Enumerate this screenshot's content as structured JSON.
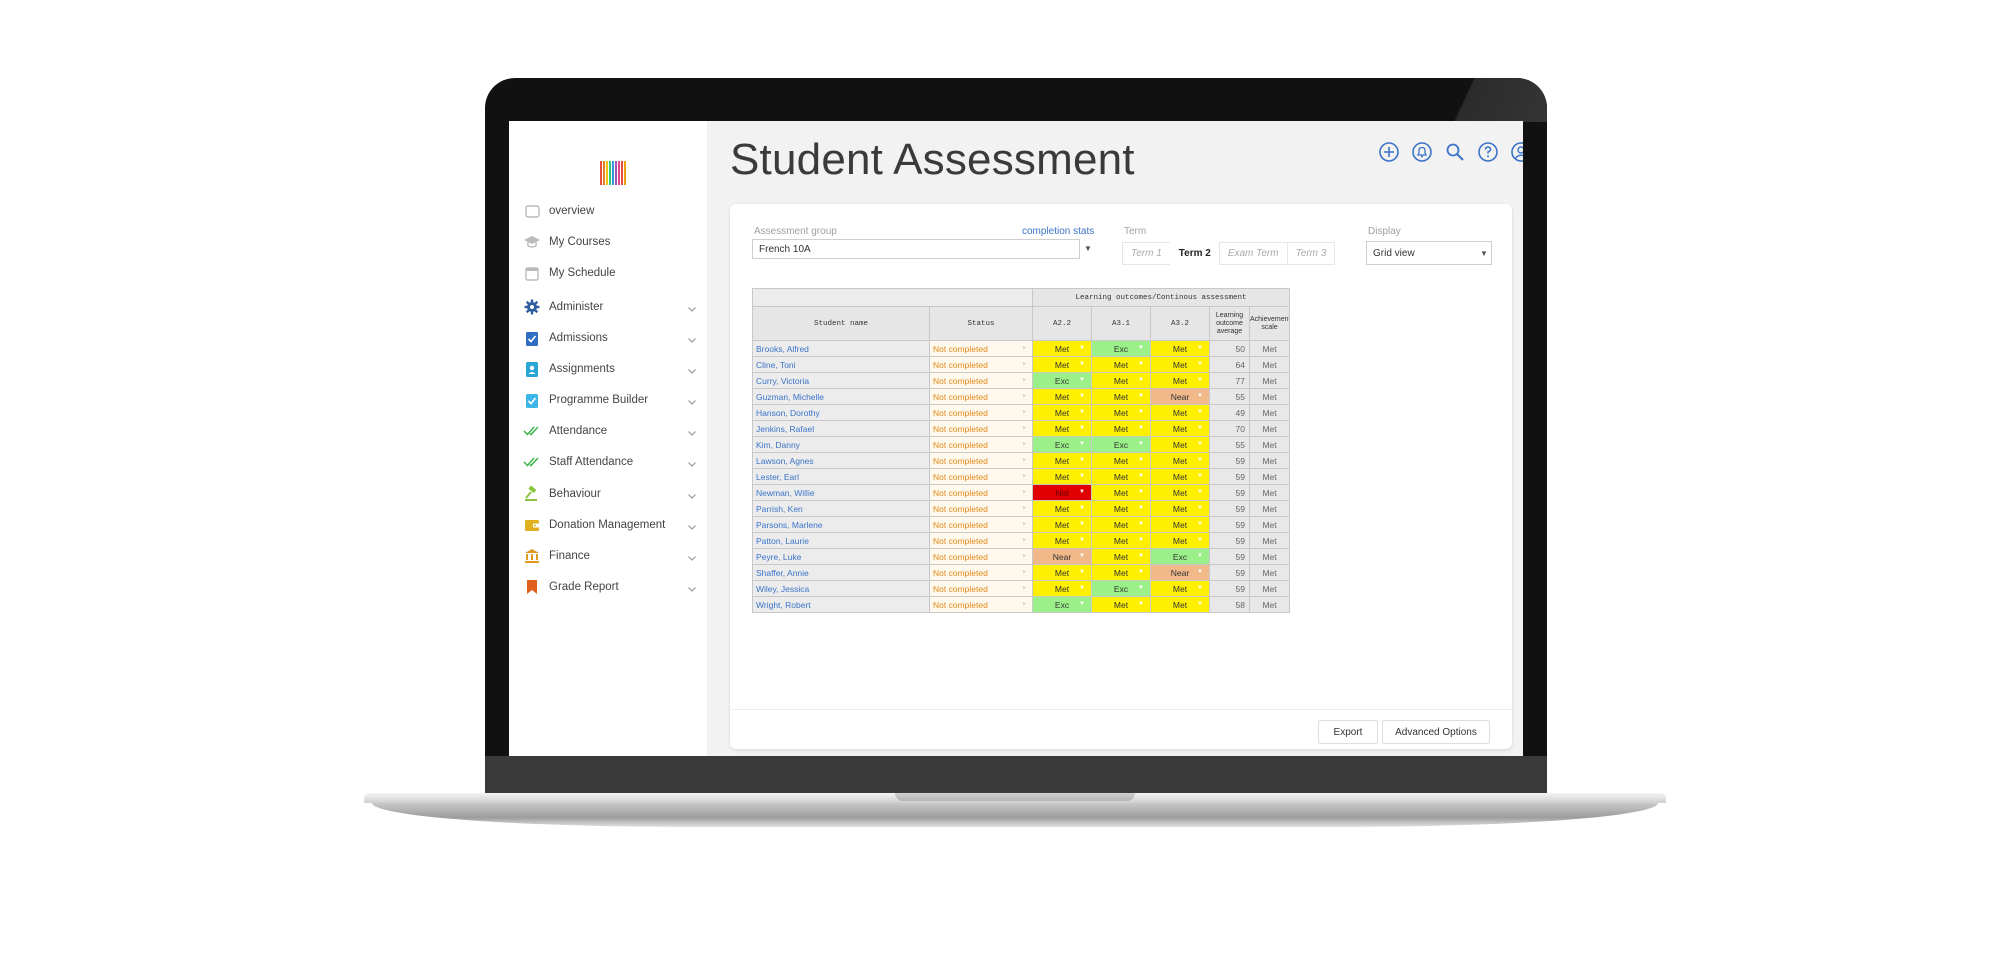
{
  "sidebar": {
    "logo_colors": [
      "#e74c3c",
      "#e67e22",
      "#f1c40f",
      "#2ecc71",
      "#3498db",
      "#9b59b6",
      "#e84393",
      "#e74c3c",
      "#f39c12"
    ],
    "items": [
      {
        "label": "overview",
        "icon": "square-outline-icon",
        "color": "#bbbbbb",
        "expandable": false
      },
      {
        "label": "My Courses",
        "icon": "graduation-cap-icon",
        "color": "#bbbbbb",
        "expandable": false
      },
      {
        "label": "My Schedule",
        "icon": "calendar-icon",
        "color": "#bbbbbb",
        "expandable": false
      },
      {
        "label": "Administer",
        "icon": "gear-icon",
        "color": "#2f5f9e",
        "expandable": true
      },
      {
        "label": "Admissions",
        "icon": "clipboard-check-icon",
        "color": "#2e6fc4",
        "expandable": true
      },
      {
        "label": "Assignments",
        "icon": "id-badge-icon",
        "color": "#2aa6d6",
        "expandable": true
      },
      {
        "label": "Programme Builder",
        "icon": "clipboard-check-light-icon",
        "color": "#3cb6e8",
        "expandable": true
      },
      {
        "label": "Attendance",
        "icon": "double-check-icon",
        "color": "#3fb54a",
        "expandable": true
      },
      {
        "label": "Staff Attendance",
        "icon": "double-check-icon",
        "color": "#3fb54a",
        "expandable": true
      },
      {
        "label": "Behaviour",
        "icon": "gavel-icon",
        "color": "#8ac43f",
        "expandable": true
      },
      {
        "label": "Donation Management",
        "icon": "wallet-icon",
        "color": "#e0b020",
        "expandable": true
      },
      {
        "label": "Finance",
        "icon": "bank-icon",
        "color": "#e09a20",
        "expandable": true
      },
      {
        "label": "Grade Report",
        "icon": "bookmark-icon",
        "color": "#e0601e",
        "expandable": true
      }
    ]
  },
  "header": {
    "title": "Student Assessment",
    "icons": [
      "add-circle-icon",
      "bell-circle-icon",
      "search-icon",
      "help-circle-icon",
      "user-circle-icon"
    ],
    "icon_color": "#3b73c8"
  },
  "filters": {
    "assessment_group_label": "Assessment group",
    "assessment_group_value": "French 10A",
    "completion_stats_link": "completion stats",
    "term_label": "Term",
    "terms": [
      "Term 1",
      "Term 2",
      "Exam Term",
      "Term 3"
    ],
    "active_term": "Term 2",
    "display_label": "Display",
    "display_value": "Grid view"
  },
  "grid": {
    "group_header": "Learning outcomes/Continous assessment",
    "columns": {
      "name": "Student name",
      "status": "Status",
      "outcomes": [
        "A2.2",
        "A3.1",
        "A3.2"
      ],
      "average": [
        "Learning",
        "outcome",
        "average"
      ],
      "scale": [
        "Achievement",
        "scale"
      ]
    },
    "rows": [
      {
        "name": "Brooks, Alfred",
        "status": "Not completed",
        "grades": [
          "Met",
          "Exc",
          "Met"
        ],
        "avg": "50",
        "scale": "Met"
      },
      {
        "name": "Cline, Toni",
        "status": "Not completed",
        "grades": [
          "Met",
          "Met",
          "Met"
        ],
        "avg": "64",
        "scale": "Met"
      },
      {
        "name": "Curry, Victoria",
        "status": "Not completed",
        "grades": [
          "Exc",
          "Met",
          "Met"
        ],
        "avg": "77",
        "scale": "Met"
      },
      {
        "name": "Guzman, Michelle",
        "status": "Not completed",
        "grades": [
          "Met",
          "Met",
          "Near"
        ],
        "avg": "55",
        "scale": "Met"
      },
      {
        "name": "Hanson, Dorothy",
        "status": "Not completed",
        "grades": [
          "Met",
          "Met",
          "Met"
        ],
        "avg": "49",
        "scale": "Met"
      },
      {
        "name": "Jenkins, Rafael",
        "status": "Not completed",
        "grades": [
          "Met",
          "Met",
          "Met"
        ],
        "avg": "70",
        "scale": "Met"
      },
      {
        "name": "Kim, Danny",
        "status": "Not completed",
        "grades": [
          "Exc",
          "Exc",
          "Met"
        ],
        "avg": "55",
        "scale": "Met"
      },
      {
        "name": "Lawson, Agnes",
        "status": "Not completed",
        "grades": [
          "Met",
          "Met",
          "Met"
        ],
        "avg": "59",
        "scale": "Met"
      },
      {
        "name": "Lester, Earl",
        "status": "Not completed",
        "grades": [
          "Met",
          "Met",
          "Met"
        ],
        "avg": "59",
        "scale": "Met"
      },
      {
        "name": "Newman, Willie",
        "status": "Not completed",
        "grades": [
          "Not",
          "Met",
          "Met"
        ],
        "avg": "59",
        "scale": "Met"
      },
      {
        "name": "Parrish, Ken",
        "status": "Not completed",
        "grades": [
          "Met",
          "Met",
          "Met"
        ],
        "avg": "59",
        "scale": "Met"
      },
      {
        "name": "Parsons, Marlene",
        "status": "Not completed",
        "grades": [
          "Met",
          "Met",
          "Met"
        ],
        "avg": "59",
        "scale": "Met"
      },
      {
        "name": "Patton, Laurie",
        "status": "Not completed",
        "grades": [
          "Met",
          "Met",
          "Met"
        ],
        "avg": "59",
        "scale": "Met"
      },
      {
        "name": "Peyre, Luke",
        "status": "Not completed",
        "grades": [
          "Near",
          "Met",
          "Exc"
        ],
        "avg": "59",
        "scale": "Met"
      },
      {
        "name": "Shaffer, Annie",
        "status": "Not completed",
        "grades": [
          "Met",
          "Met",
          "Near"
        ],
        "avg": "59",
        "scale": "Met"
      },
      {
        "name": "Wiley, Jessica",
        "status": "Not completed",
        "grades": [
          "Met",
          "Exc",
          "Met"
        ],
        "avg": "59",
        "scale": "Met"
      },
      {
        "name": "Wright, Robert",
        "status": "Not completed",
        "grades": [
          "Exc",
          "Met",
          "Met"
        ],
        "avg": "58",
        "scale": "Met"
      }
    ]
  },
  "footer": {
    "export_label": "Export",
    "advanced_label": "Advanced Options"
  }
}
